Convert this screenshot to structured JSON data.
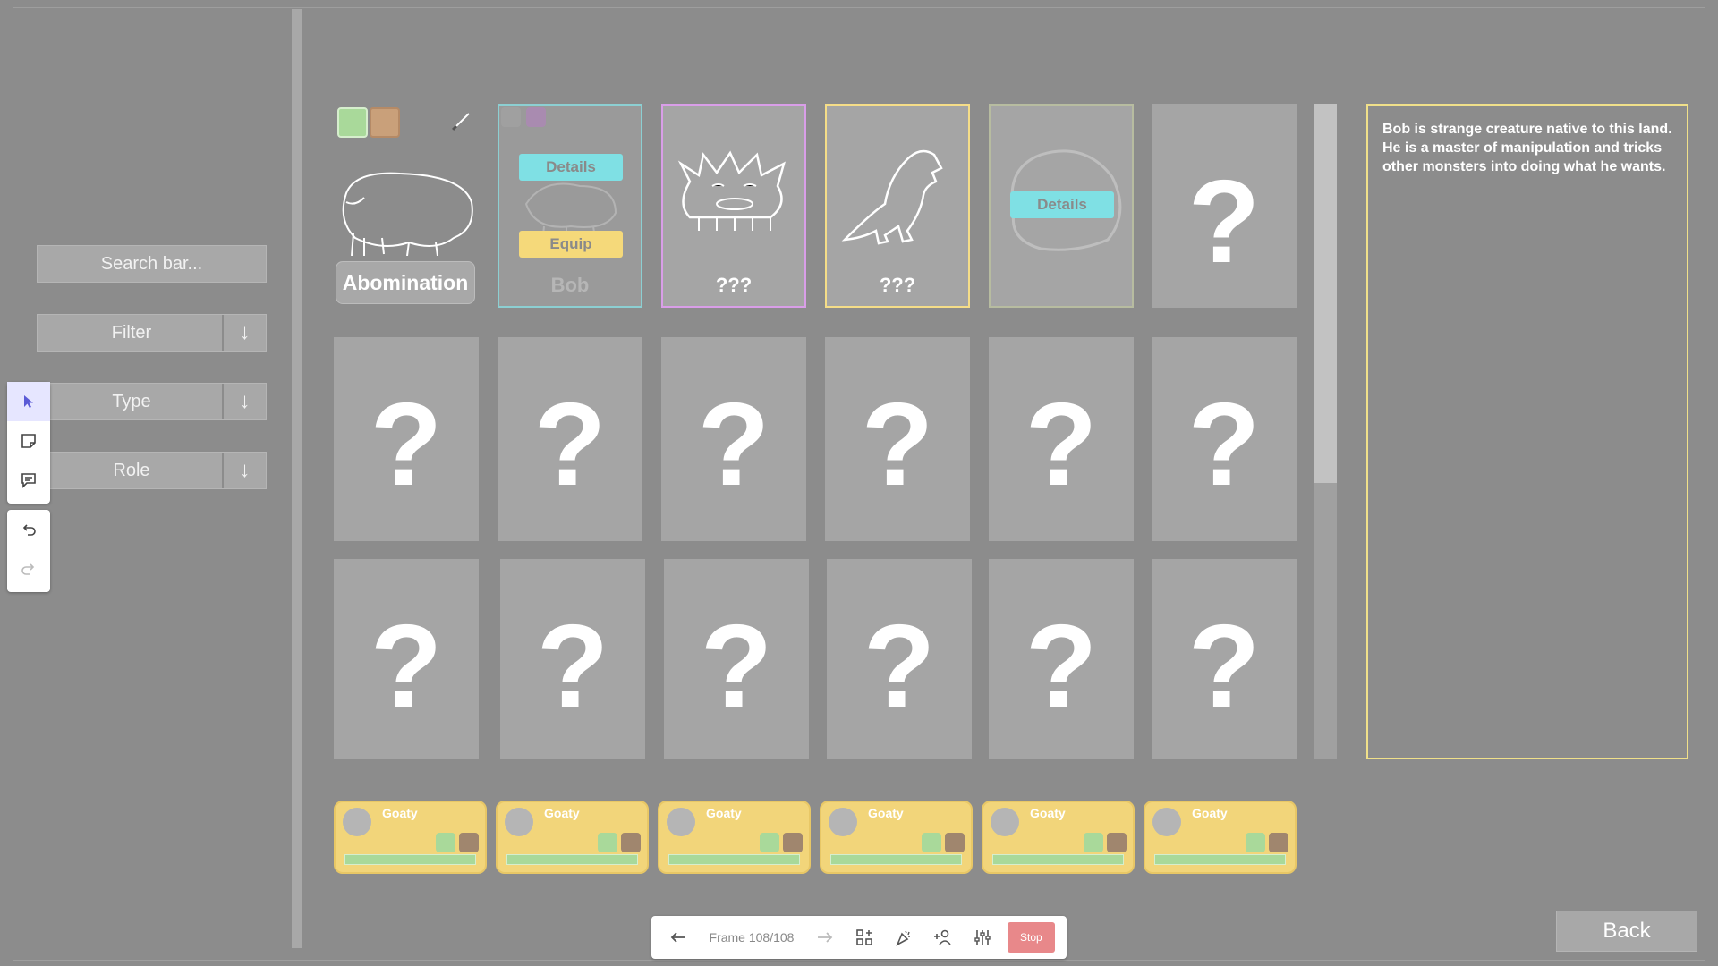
{
  "sidebar": {
    "search_placeholder": "Search bar...",
    "filter_label": "Filter",
    "type_label": "Type",
    "role_label": "Role",
    "dropdown_arrow": "↓"
  },
  "cards": {
    "abomination_name": "Abomination",
    "bob_name": "Bob",
    "unknown_name_1": "???",
    "unknown_name_2": "???",
    "details_label": "Details",
    "equip_label": "Equip",
    "locked_symbol": "?"
  },
  "description": {
    "text": "Bob is strange creature native to this land. He is a master of manipulation and tricks other monsters into doing what he wants."
  },
  "team": {
    "members": [
      "Goaty",
      "Goaty",
      "Goaty",
      "Goaty",
      "Goaty",
      "Goaty"
    ]
  },
  "back_label": "Back",
  "bottom_bar": {
    "frame_text": "Frame 108/108",
    "stop_label": "Stop"
  },
  "colors": {
    "background": "#8c8c8c",
    "card_gray": "#a5a5a5",
    "details_cyan": "#7fe0e4",
    "equip_yellow": "#f5d97a",
    "border_purple": "#d99ee8",
    "border_yellow": "#f5dd88"
  }
}
